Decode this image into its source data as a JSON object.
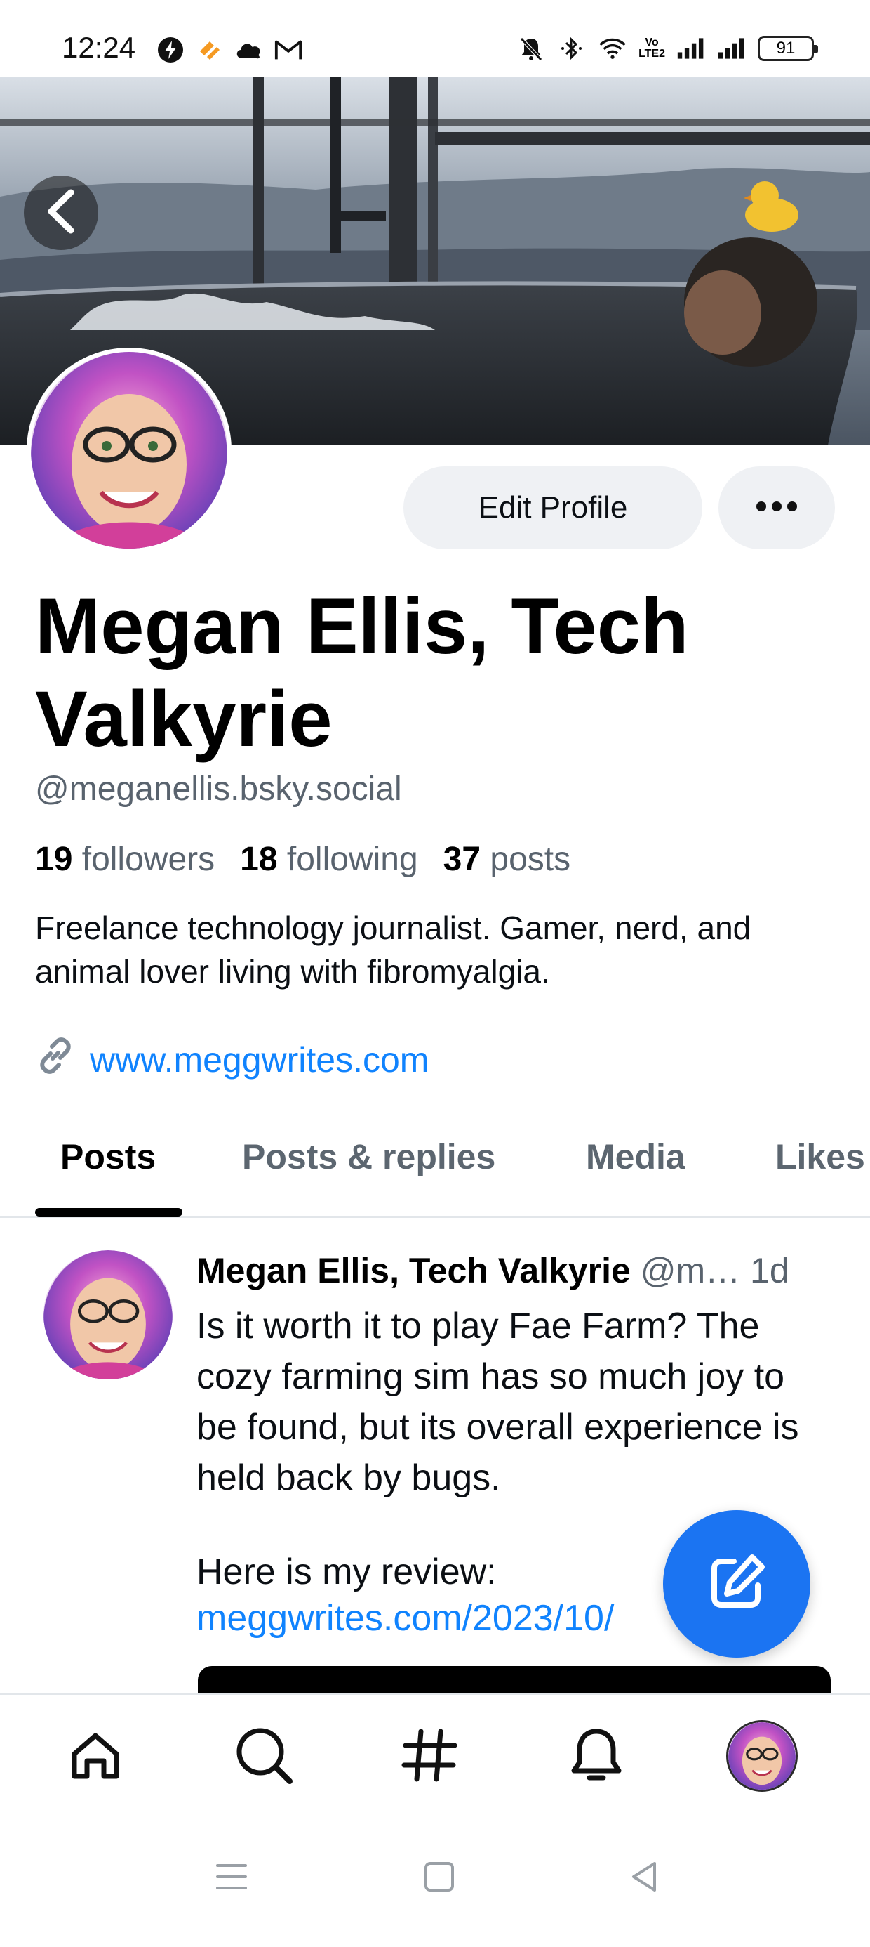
{
  "status_bar": {
    "time": "12:24",
    "battery": "91",
    "network": "VoLTE2",
    "left_icons": [
      "messenger-bolt-icon",
      "app-icon",
      "cloud-icon",
      "gmail-icon"
    ],
    "right_icons": [
      "mute-icon",
      "bluetooth-icon",
      "wifi-icon",
      "signal-icon",
      "signal-icon"
    ]
  },
  "profile": {
    "display_name": "Megan Ellis, Tech Valkyrie",
    "handle": "@meganellis.bsky.social",
    "edit_label": "Edit Profile",
    "more_label": "•••",
    "stats": {
      "followers_count": "19",
      "followers_label": "followers",
      "following_count": "18",
      "following_label": "following",
      "posts_count": "37",
      "posts_label": "posts"
    },
    "bio": "Freelance technology journalist. Gamer, nerd, and animal lover living with fibromyalgia.",
    "link": "www.meggwrites.com"
  },
  "tabs": [
    {
      "label": "Posts"
    },
    {
      "label": "Posts & replies"
    },
    {
      "label": "Media"
    },
    {
      "label": "Likes"
    }
  ],
  "post": {
    "author": "Megan Ellis, Tech Valkyrie",
    "handle": "@m…",
    "time": "1d",
    "text": "Is it worth it to play Fae Farm? The cozy farming sim has so much joy to be found, but its overall experience is held back by bugs.",
    "review_label": "Here is my review:",
    "url": "meggwrites.com/2023/10/"
  },
  "bottom_nav": [
    "home-icon",
    "search-icon",
    "feeds-hash-icon",
    "notifications-icon",
    "profile-avatar"
  ],
  "colors": {
    "accent": "#1083fe",
    "fab": "#1b74f2",
    "pill_bg": "#eff1f4",
    "muted_text": "#59636e"
  }
}
